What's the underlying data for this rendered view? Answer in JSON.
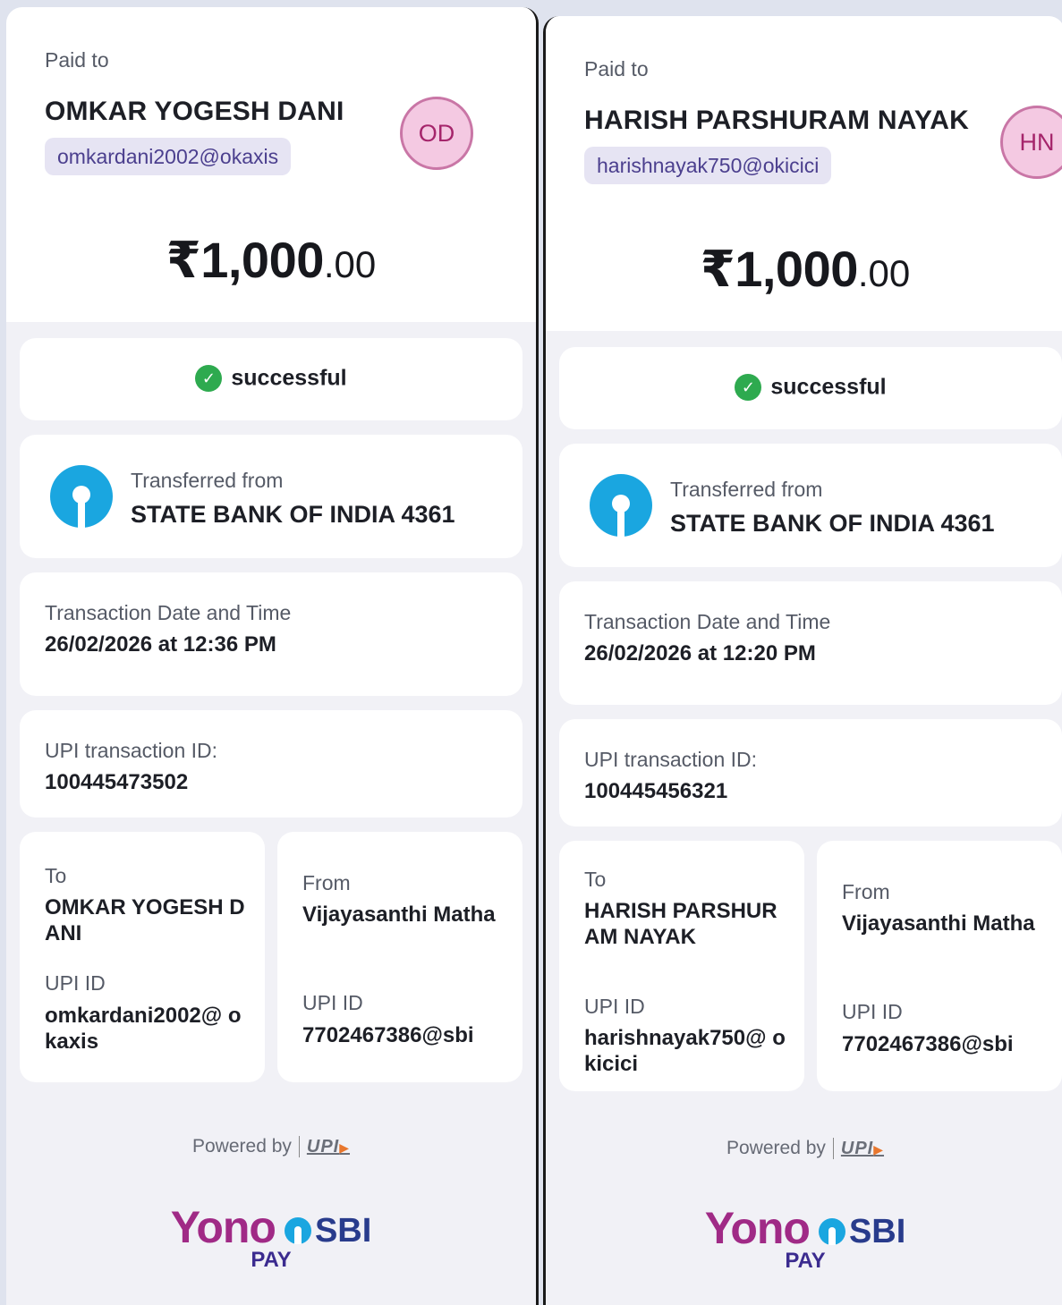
{
  "receipts": [
    {
      "paid_to_label": "Paid to",
      "payee_name": "OMKAR YOGESH DANI",
      "payee_upi": "omkardani2002@okaxis",
      "avatar_initials": "OD",
      "amount_main": "₹1,000",
      "amount_decimal": ".00",
      "status_text": "successful",
      "status_icon": "check-circle-icon",
      "transferred_from_label": "Transferred from",
      "bank_name": "STATE BANK OF INDIA 4361",
      "date_label": "Transaction Date and Time",
      "date_value": "26/02/2026 at 12:36 PM",
      "txn_id_label": "UPI transaction ID:",
      "txn_id_value": "100445473502",
      "to_label": "To",
      "to_name": "OMKAR YOGESH DANI",
      "to_upi_label": "UPI ID",
      "to_upi_value": "omkardani2002@ okaxis",
      "from_label": "From",
      "from_name": "Vijayasanthi Matha",
      "from_upi_label": "UPI ID",
      "from_upi_value": "7702467386@sbi",
      "powered_by": "Powered by",
      "upi_logo_text": "UPI",
      "brand_yono": "Yono",
      "brand_sbi": "SBI",
      "brand_pay": "PAY"
    },
    {
      "paid_to_label": "Paid to",
      "payee_name": "HARISH PARSHURAM NAYAK",
      "payee_upi": "harishnayak750@okicici",
      "avatar_initials": "HN",
      "amount_main": "₹1,000",
      "amount_decimal": ".00",
      "status_text": "successful",
      "status_icon": "check-circle-icon",
      "transferred_from_label": "Transferred from",
      "bank_name": "STATE BANK OF INDIA 4361",
      "date_label": "Transaction Date and Time",
      "date_value": "26/02/2026 at 12:20 PM",
      "txn_id_label": "UPI transaction ID:",
      "txn_id_value": "100445456321",
      "to_label": "To",
      "to_name": "HARISH PARSHURAM NAYAK",
      "to_upi_label": "UPI ID",
      "to_upi_value": "harishnayak750@ okicici",
      "from_label": "From",
      "from_name": "Vijayasanthi Matha",
      "from_upi_label": "UPI ID",
      "from_upi_value": "7702467386@sbi",
      "powered_by": "Powered by",
      "upi_logo_text": "UPI",
      "brand_yono": "Yono",
      "brand_sbi": "SBI",
      "brand_pay": "PAY"
    }
  ],
  "colors": {
    "accent_purple": "#4b3f8e",
    "avatar_bg": "#f4c9e2",
    "success_green": "#2eaa4f",
    "sbi_blue": "#1aa6e0",
    "yono_magenta": "#a02a86"
  }
}
